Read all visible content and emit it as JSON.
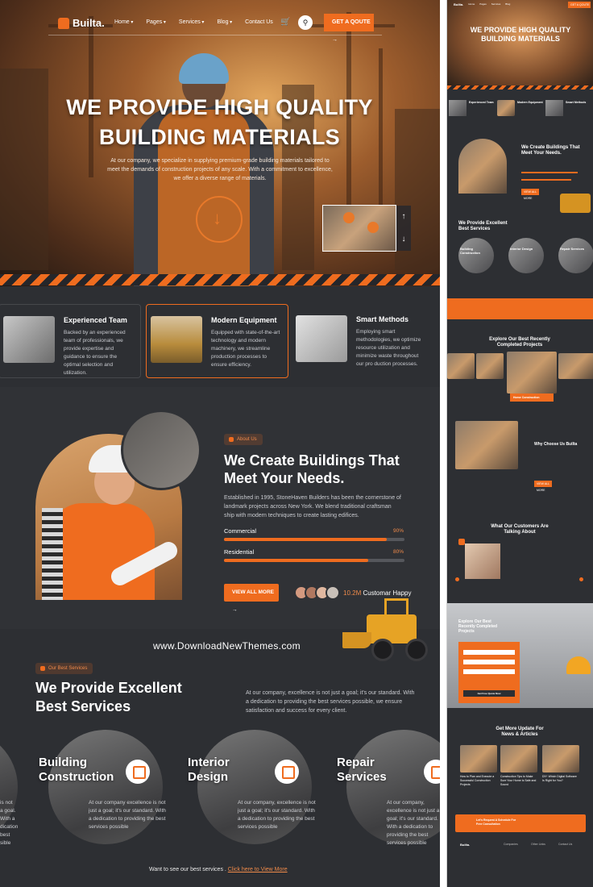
{
  "nav": {
    "brand": "Builta.",
    "links": [
      "Home",
      "Pages",
      "Services",
      "Blog",
      "Contact Us"
    ],
    "quote_button": "GET A QOUTE"
  },
  "hero": {
    "title_line1": "WE PROVIDE HIGH QUALITY",
    "title_line2": "BUILDING MATERIALS",
    "description": "At our company, we specialize in supplying premium-grade building materials tailored to meet the demands of construction projects of any scale. With a commitment to excellence, we offer a diverse range of materials."
  },
  "features": [
    {
      "title": "Experienced Team",
      "text": "Backed by an experienced team of professionals, we provide expertise and guidance to ensure the optimal selection and utilization."
    },
    {
      "title": "Modern Equipment",
      "text": "Equipped with state-of-the-art technology and modern machinery, we streamline production processes to ensure efficiency."
    },
    {
      "title": "Smart Methods",
      "text": "Employing smart methodologies, we optimize resource utilization and minimize waste throughout our pro duction processes."
    }
  ],
  "about": {
    "badge": "About Us",
    "title_line1": "We Create Buildings That",
    "title_line2": "Meet Your Needs.",
    "text": "Established in 1995, StoneHaven Builders has been the cornerstone of landmark projects across New York. We blend traditional craftsman ship with modern techniques to create lasting edifices.",
    "skills": [
      {
        "label": "Commercial",
        "pct_text": "90%",
        "value": 0.9
      },
      {
        "label": "Residential",
        "pct_text": "80%",
        "value": 0.8
      }
    ],
    "button": "VIEW ALL MORE",
    "happy_count": "10.2M",
    "happy_label": "Customar Happy"
  },
  "watermark": "www.DownloadNewThemes.com",
  "services": {
    "badge": "Our Best Services",
    "title_line1": "We Provide Excellent",
    "title_line2": "Best Services",
    "text": "At our company, excellence is not just a goal; it's our standard. With a dedication to providing the best services possible, we ensure satisfaction and success for every client.",
    "items": [
      {
        "title_line1": "Building",
        "title_line2": "Construction",
        "text": "At our company excellence is not just a goal; it's our standard. With a dedication to providing the best services possible"
      },
      {
        "title_line1": "Interior",
        "title_line2": "Design",
        "text": "At our company, excellence is not just a goal; it's our standard. With a dedication to providing the best services possible"
      },
      {
        "title_line1": "Repair",
        "title_line2": "Services",
        "text": "At our company, excellence is not just a goal; it's our standard. With a dedication to providing the best services possible"
      }
    ],
    "left_clip_text": "is not a goal. With a dication best sible",
    "more_prefix": "Want to see our best services .",
    "more_link": "Click here to View More"
  },
  "side": {
    "hero_title_line1": "WE PROVIDE HIGH QUALITY",
    "hero_title_line2": "BUILDING MATERIALS",
    "features": [
      "Experienced Team",
      "Modern Equipment",
      "Smart Methods"
    ],
    "about_title_line1": "We Create Buildings That",
    "about_title_line2": "Meet Your Needs.",
    "services_title_line1": "We Provide Excellent",
    "services_title_line2": "Best Services",
    "svc_labels": [
      "Building Construction",
      "Interior Design",
      "Repair Services"
    ],
    "projects_title_line1": "Explore Our Best Recently",
    "projects_title_line2": "Completed Projects",
    "projects_card": "Home Construction",
    "why_title": "Why Choose Us Builta",
    "testimonial_title_line1": "What Our Customers Are",
    "testimonial_title_line2": "Talking About",
    "cta_title_line1": "Explore Our Best",
    "cta_title_line2": "Recently Completed",
    "cta_title_line3": "Projects",
    "cta_button": "Get Free Quote Now",
    "news_title_line1": "Get More Update For",
    "news_title_line2": "News & Articles",
    "news_items": [
      "How to Plan and Execute a Successful Construction Projects",
      "Construction Tips to Make Sure Your Home Is Safe and Sound",
      "DIY: Which Digital Software Is Right for You?"
    ],
    "banner_line1": "Let's Request A Schedule For",
    "banner_line2": "Free Consultation",
    "footer_brand": "Builta.",
    "footer_cols": [
      "Companies",
      "Other Links",
      "Contact Us"
    ]
  },
  "colors": {
    "accent": "#ef6c1f",
    "dark": "#2d2f33"
  }
}
